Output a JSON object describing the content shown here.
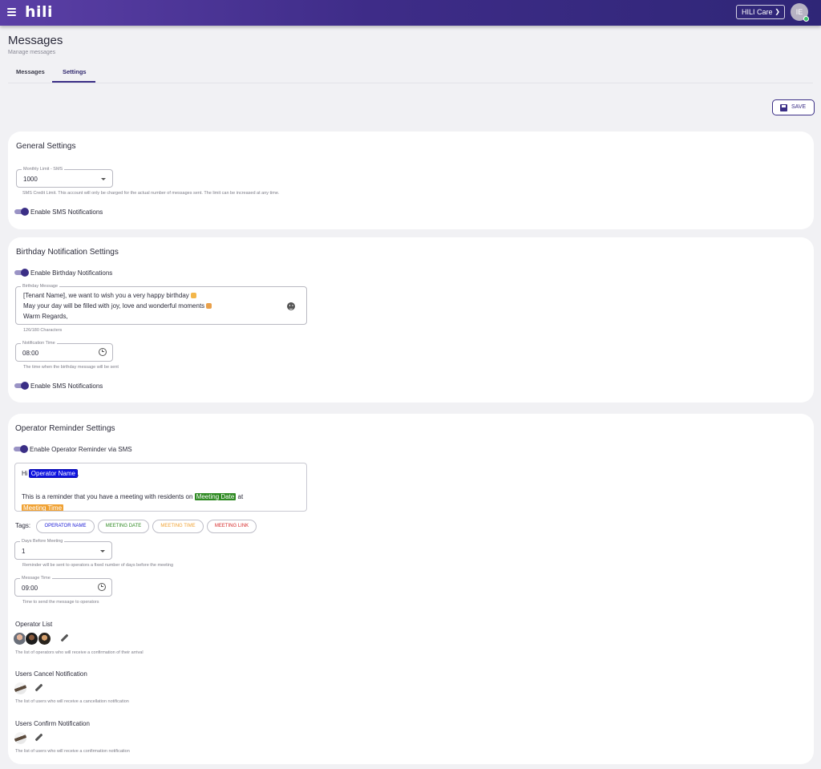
{
  "topbar": {
    "logo": "hili",
    "org_select": "HILI Care",
    "avatar_initials": "IE"
  },
  "header": {
    "title": "Messages",
    "subtitle": "Manage messages",
    "tabs": [
      {
        "label": "Messages",
        "active": false
      },
      {
        "label": "Settings",
        "active": true
      }
    ]
  },
  "toolbar": {
    "save_label": "SAVE"
  },
  "general": {
    "title": "General Settings",
    "monthly_limit": {
      "legend": "Monthly Limit - SMS",
      "value": "1000",
      "helper": "SMS Credit Limit. This account will only be charged for the actual number of messages sent. The limit can be increased at any time."
    },
    "sms_toggle": {
      "label": "Enable SMS Notifications",
      "on": true
    }
  },
  "birthday": {
    "title": "Birthday Notification Settings",
    "enable_toggle": {
      "label": "Enable Birthday Notifications",
      "on": true
    },
    "message": {
      "legend": "Birthday Message",
      "line1": "[Tenant Name], we want to wish you a very happy birthday",
      "line2": "May your day will be filled with joy, love and wonderful moments",
      "line3": "Warm Regards,",
      "counter": "126/180 Characters"
    },
    "time": {
      "legend": "Notification Time",
      "value": "08:00",
      "helper": "The time when the birthday message will be sent"
    },
    "sms_toggle": {
      "label": "Enable SMS Notifications",
      "on": true
    }
  },
  "operator": {
    "title": "Operator Reminder Settings",
    "sms_toggle": {
      "label": "Enable Operator Reminder via SMS",
      "on": true
    },
    "editor": {
      "greeting": "Hi",
      "operator_name": "Operator Name",
      "comma": ",",
      "reminder_text": "This is a reminder that you have a meeting with residents on",
      "meeting_date": "Meeting Date",
      "at": "at",
      "meeting_time": "Meeting Time"
    },
    "tags_label": "Tags:",
    "tags": [
      {
        "label": "OPERATOR NAME",
        "color": "#1a1ad6"
      },
      {
        "label": "MEETING DATE",
        "color": "#2f8a23"
      },
      {
        "label": "MEETING TIME",
        "color": "#f0a234"
      },
      {
        "label": "MEETING LINK",
        "color": "#d62a2a"
      }
    ],
    "days_before": {
      "legend": "Days Before Meeting",
      "value": "1",
      "helper": "Reminder will be sent to operators a fixed number of days before the meeting"
    },
    "message_time": {
      "legend": "Message Time",
      "value": "09:00",
      "helper": "Time to send the message to operators"
    },
    "operator_list": {
      "label": "Operator List",
      "helper": "The list of operators who will receive a confirmation of their arrival"
    },
    "users_cancel": {
      "label": "Users Cancel Notification",
      "helper": "The list of users who will receive a cancellation notification"
    },
    "users_confirm": {
      "label": "Users Confirm Notification",
      "helper": "The list of users who will receive a confirmation notification"
    }
  },
  "colors": {
    "accent": "#3b2f86",
    "topbar_start": "#5b3fa6",
    "topbar_end": "#2f2677"
  }
}
